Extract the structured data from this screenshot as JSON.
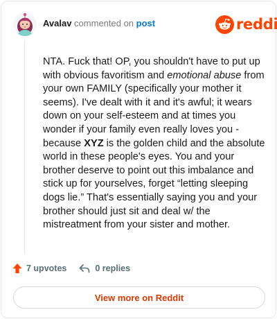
{
  "header": {
    "username": "Avalav",
    "action_text": " commented on ",
    "post_link_text": "post"
  },
  "brand": {
    "name": "reddit",
    "color": "#ff4500",
    "icon": "reddit-snoo-icon"
  },
  "comment": {
    "p1": "NTA. Fuck that! OP, you shouldn't have to put up with obvious favoritism and ",
    "em": "emotional abuse",
    "p2": " from your own FAMILY (specifically your mother it seems). I've dealt with it and it's awful; it wears down on your self-esteem and at times you wonder if your family even really loves you - because ",
    "strong": "XYZ",
    "p3": " is the golden child and the absolute world in these people's eyes. You and your brother deserve to point out this imbalance and stick up for yourselves, forget “letting sleeping dogs lie.” That's essentially saying you and your brother should just sit and deal w/ the mistreatment from your sister and mother."
  },
  "actions": {
    "upvotes": "7 upvotes",
    "upvote_icon": "upvote-arrow-icon",
    "replies": "0 replies",
    "reply_icon": "reply-icon"
  },
  "footer": {
    "view_more": "View more on Reddit"
  },
  "colors": {
    "accent": "#ff4500",
    "link": "#0079d3",
    "view_more_text": "#d93a00"
  }
}
